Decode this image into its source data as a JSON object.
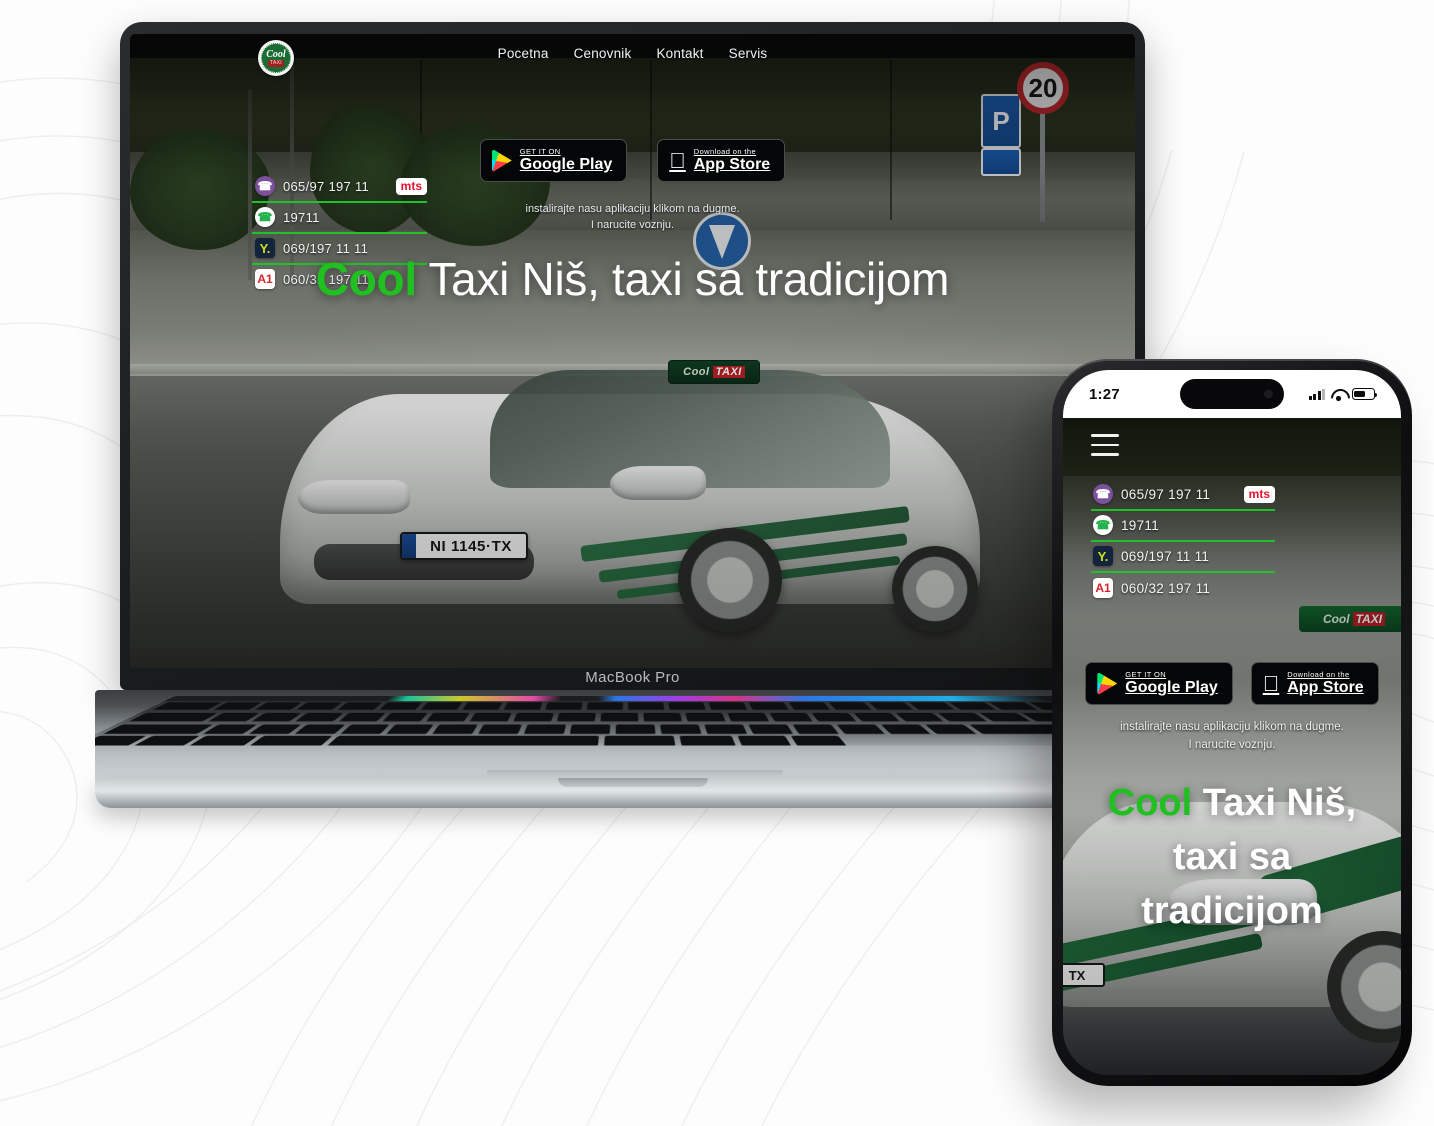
{
  "background": {
    "pattern": "topographic-contours",
    "color": "#ffffff",
    "line_color": "#efefef"
  },
  "devices": {
    "laptop": {
      "model_label": "MacBook Pro"
    },
    "phone": {
      "status_bar": {
        "time": "1:27",
        "signal_icon": "cellular-signal-icon",
        "wifi_icon": "wifi-icon",
        "battery_icon": "battery-icon"
      },
      "menu_icon": "hamburger-menu-icon"
    }
  },
  "site": {
    "brand": {
      "logo_text": "Cool",
      "logo_sub": "TAXI"
    },
    "nav": [
      {
        "label": "Pocetna"
      },
      {
        "label": "Cenovnik"
      },
      {
        "label": "Kontakt"
      },
      {
        "label": "Servis"
      }
    ],
    "contacts": [
      {
        "icon": "viber-icon",
        "glyph": "✆",
        "number": "065/97 197 11",
        "badge": "mts"
      },
      {
        "icon": "phone-icon",
        "glyph": "✆",
        "number": "19711",
        "badge": ""
      },
      {
        "icon": "yettel-icon",
        "glyph": "Y.",
        "number": "069/197 11 11",
        "badge": ""
      },
      {
        "icon": "a1-icon",
        "glyph": "A1",
        "number": "060/32 197 11",
        "badge": ""
      }
    ],
    "stores": [
      {
        "name": "google-play-badge",
        "line1": "GET IT ON",
        "line2": "Google Play",
        "icon": "google-play-icon"
      },
      {
        "name": "app-store-badge",
        "line1": "Download on the",
        "line2": "App Store",
        "icon": "apple-icon",
        "glyph": ""
      }
    ],
    "install_text_line1": "instalirajte nasu aplikaciju klikom na dugme.",
    "install_text_line2": "I narucite voznju.",
    "headline": {
      "accent": "Cool",
      "rest": " Taxi Niš, taxi sa tradicijom",
      "mobile_rest": " Taxi Niš, taxi sa tradicijom"
    },
    "photo": {
      "license_plate": "NI 1145·TX",
      "license_plate_mobile": "TX",
      "roof_sign_cool": "Cool",
      "roof_sign_taxi": "TAXI",
      "parking_sign": "P",
      "speed_limit_sign": "20"
    },
    "colors": {
      "accent_green": "#20c020",
      "divider_green": "#1fc22a",
      "mts_red": "#e8112d",
      "a1_red": "#d8232a",
      "viber_purple": "#7b519d",
      "yettel_navy": "#15243d",
      "text_white": "#ffffff"
    }
  }
}
